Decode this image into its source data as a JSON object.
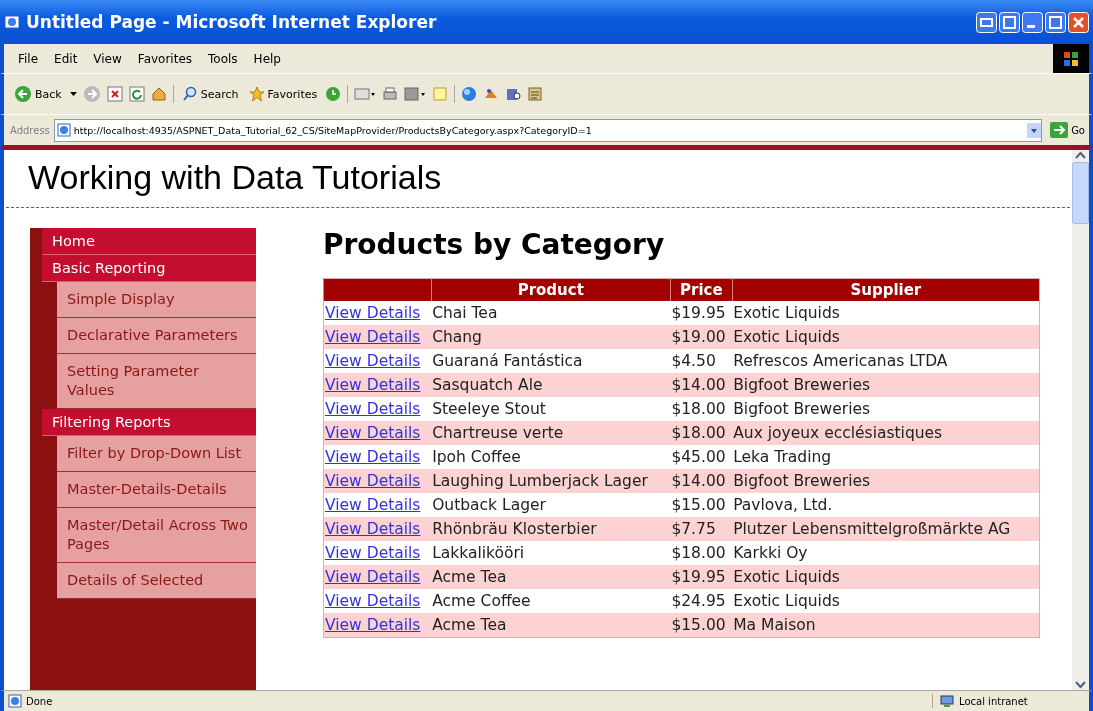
{
  "window": {
    "title": "Untitled Page - Microsoft Internet Explorer"
  },
  "menu": [
    "File",
    "Edit",
    "View",
    "Favorites",
    "Tools",
    "Help"
  ],
  "toolbar": {
    "back": "Back",
    "search": "Search",
    "favorites": "Favorites"
  },
  "address": {
    "label": "Address",
    "url": "http://localhost:4935/ASPNET_Data_Tutorial_62_CS/SiteMapProvider/ProductsByCategory.aspx?CategoryID=1",
    "go": "Go"
  },
  "page": {
    "site_title": "Working with Data Tutorials",
    "heading": "Products by Category"
  },
  "sidebar": {
    "items": [
      {
        "label": "Home"
      },
      {
        "label": "Basic Reporting",
        "children": [
          {
            "label": "Simple Display"
          },
          {
            "label": "Declarative Parameters"
          },
          {
            "label": "Setting Parameter Values"
          }
        ]
      },
      {
        "label": "Filtering Reports",
        "children": [
          {
            "label": "Filter by Drop-Down List"
          },
          {
            "label": "Master-Details-Details"
          },
          {
            "label": "Master/Detail Across Two Pages"
          },
          {
            "label": "Details of Selected"
          }
        ]
      }
    ]
  },
  "table": {
    "columns": [
      "Product",
      "Price",
      "Supplier"
    ],
    "rows": [
      {
        "link": "View Details",
        "product": "Chai Tea",
        "price": "$19.95",
        "supplier": "Exotic Liquids"
      },
      {
        "link": "View Details",
        "product": "Chang",
        "price": "$19.00",
        "supplier": "Exotic Liquids"
      },
      {
        "link": "View Details",
        "product": "Guaraná Fantástica",
        "price": "$4.50",
        "supplier": "Refrescos Americanas LTDA"
      },
      {
        "link": "View Details",
        "product": "Sasquatch Ale",
        "price": "$14.00",
        "supplier": "Bigfoot Breweries"
      },
      {
        "link": "View Details",
        "product": "Steeleye Stout",
        "price": "$18.00",
        "supplier": "Bigfoot Breweries"
      },
      {
        "link": "View Details",
        "product": "Chartreuse verte",
        "price": "$18.00",
        "supplier": "Aux joyeux ecclésiastiques"
      },
      {
        "link": "View Details",
        "product": "Ipoh Coffee",
        "price": "$45.00",
        "supplier": "Leka Trading"
      },
      {
        "link": "View Details",
        "product": "Laughing Lumberjack Lager",
        "price": "$14.00",
        "supplier": "Bigfoot Breweries"
      },
      {
        "link": "View Details",
        "product": "Outback Lager",
        "price": "$15.00",
        "supplier": "Pavlova, Ltd."
      },
      {
        "link": "View Details",
        "product": "Rhönbräu Klosterbier",
        "price": "$7.75",
        "supplier": "Plutzer Lebensmittelgroßmärkte AG"
      },
      {
        "link": "View Details",
        "product": "Lakkalikööri",
        "price": "$18.00",
        "supplier": "Karkki Oy"
      },
      {
        "link": "View Details",
        "product": "Acme Tea",
        "price": "$19.95",
        "supplier": "Exotic Liquids"
      },
      {
        "link": "View Details",
        "product": "Acme Coffee",
        "price": "$24.95",
        "supplier": "Exotic Liquids"
      },
      {
        "link": "View Details",
        "product": "Acme Tea",
        "price": "$15.00",
        "supplier": "Ma Maison"
      }
    ]
  },
  "status_bar": {
    "status": "Done",
    "zone": "Local intranet"
  }
}
